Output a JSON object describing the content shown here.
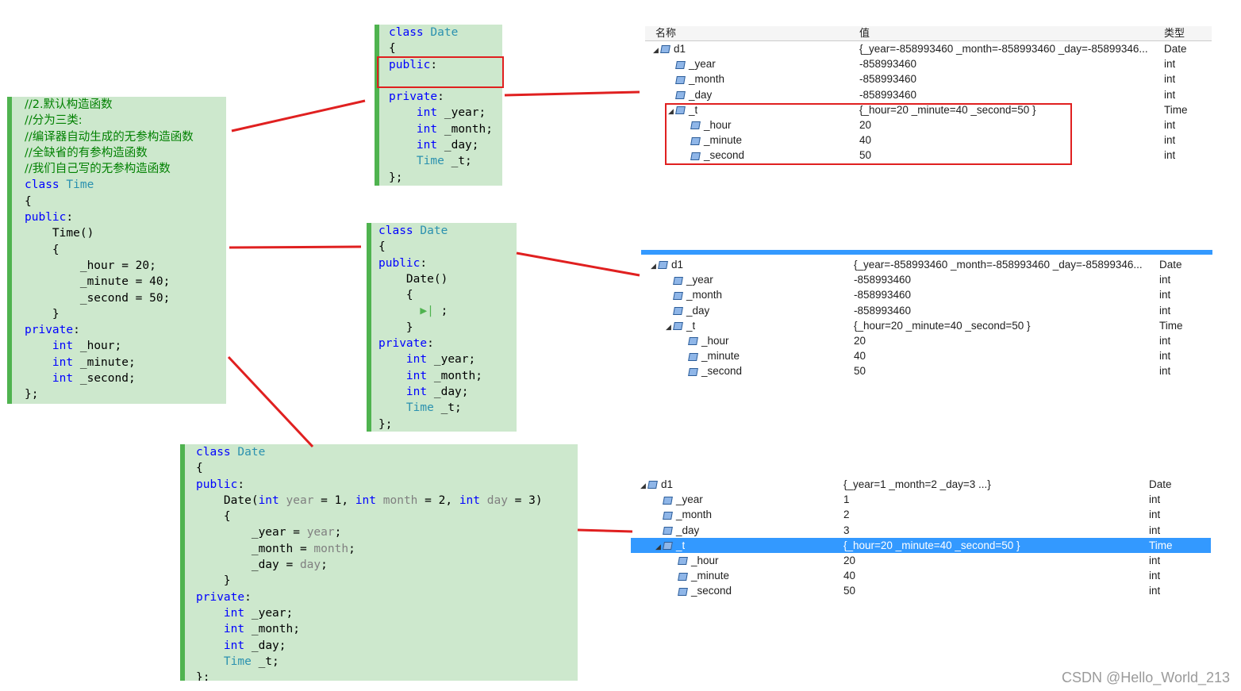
{
  "panel_time": {
    "lines": [
      [
        {
          "c": "cm",
          "t": "//2.默认构造函数"
        }
      ],
      [
        {
          "c": "cm",
          "t": "//分为三类:"
        }
      ],
      [
        {
          "c": "cm",
          "t": "//编译器自动生成的无参构造函数"
        }
      ],
      [
        {
          "c": "cm",
          "t": "//全缺省的有参构造函数"
        }
      ],
      [
        {
          "c": "cm",
          "t": "//我们自己写的无参构造函数"
        }
      ],
      [
        {
          "c": "kw",
          "t": "class "
        },
        {
          "c": "ty",
          "t": "Time"
        }
      ],
      [
        {
          "c": "tx",
          "t": "{"
        }
      ],
      [
        {
          "c": "kw",
          "t": "public"
        },
        {
          "c": "tx",
          "t": ":"
        }
      ],
      [
        {
          "c": "tx",
          "t": "    Time()"
        }
      ],
      [
        {
          "c": "tx",
          "t": "    {"
        }
      ],
      [
        {
          "c": "tx",
          "t": "        _hour = 20;"
        }
      ],
      [
        {
          "c": "tx",
          "t": "        _minute = 40;"
        }
      ],
      [
        {
          "c": "tx",
          "t": "        _second = 50;"
        }
      ],
      [
        {
          "c": "tx",
          "t": "    }"
        }
      ],
      [
        {
          "c": "kw",
          "t": "private"
        },
        {
          "c": "tx",
          "t": ":"
        }
      ],
      [
        {
          "c": "tx",
          "t": "    "
        },
        {
          "c": "kw",
          "t": "int"
        },
        {
          "c": "tx",
          "t": " _hour;"
        }
      ],
      [
        {
          "c": "tx",
          "t": "    "
        },
        {
          "c": "kw",
          "t": "int"
        },
        {
          "c": "tx",
          "t": " _minute;"
        }
      ],
      [
        {
          "c": "tx",
          "t": "    "
        },
        {
          "c": "kw",
          "t": "int"
        },
        {
          "c": "tx",
          "t": " _second;"
        }
      ],
      [
        {
          "c": "tx",
          "t": "};"
        }
      ]
    ]
  },
  "panel_date1": {
    "lines": [
      [
        {
          "c": "kw",
          "t": "class "
        },
        {
          "c": "ty",
          "t": "Date"
        }
      ],
      [
        {
          "c": "tx",
          "t": "{"
        }
      ],
      [
        {
          "c": "kw",
          "t": "public"
        },
        {
          "c": "tx",
          "t": ":"
        }
      ],
      [
        {
          "c": "tx",
          "t": ""
        }
      ],
      [
        {
          "c": "kw",
          "t": "private"
        },
        {
          "c": "tx",
          "t": ":"
        }
      ],
      [
        {
          "c": "tx",
          "t": "    "
        },
        {
          "c": "kw",
          "t": "int"
        },
        {
          "c": "tx",
          "t": " _year;"
        }
      ],
      [
        {
          "c": "tx",
          "t": "    "
        },
        {
          "c": "kw",
          "t": "int"
        },
        {
          "c": "tx",
          "t": " _month;"
        }
      ],
      [
        {
          "c": "tx",
          "t": "    "
        },
        {
          "c": "kw",
          "t": "int"
        },
        {
          "c": "tx",
          "t": " _day;"
        }
      ],
      [
        {
          "c": "tx",
          "t": "    "
        },
        {
          "c": "ty",
          "t": "Time"
        },
        {
          "c": "tx",
          "t": " _t;"
        }
      ],
      [
        {
          "c": "tx",
          "t": "};"
        }
      ]
    ]
  },
  "panel_date2": {
    "lines": [
      [
        {
          "c": "kw",
          "t": "class "
        },
        {
          "c": "ty",
          "t": "Date"
        }
      ],
      [
        {
          "c": "tx",
          "t": "{"
        }
      ],
      [
        {
          "c": "kw",
          "t": "public"
        },
        {
          "c": "tx",
          "t": ":"
        }
      ],
      [
        {
          "c": "tx",
          "t": "    Date()"
        }
      ],
      [
        {
          "c": "tx",
          "t": "    {"
        }
      ],
      [
        {
          "c": "tx",
          "t": "      "
        },
        {
          "c": "arrow",
          "t": "▶|"
        },
        {
          "c": "tx",
          "t": " ;"
        }
      ],
      [
        {
          "c": "tx",
          "t": "    }"
        }
      ],
      [
        {
          "c": "kw",
          "t": "private"
        },
        {
          "c": "tx",
          "t": ":"
        }
      ],
      [
        {
          "c": "tx",
          "t": "    "
        },
        {
          "c": "kw",
          "t": "int"
        },
        {
          "c": "tx",
          "t": " _year;"
        }
      ],
      [
        {
          "c": "tx",
          "t": "    "
        },
        {
          "c": "kw",
          "t": "int"
        },
        {
          "c": "tx",
          "t": " _month;"
        }
      ],
      [
        {
          "c": "tx",
          "t": "    "
        },
        {
          "c": "kw",
          "t": "int"
        },
        {
          "c": "tx",
          "t": " _day;"
        }
      ],
      [
        {
          "c": "tx",
          "t": "    "
        },
        {
          "c": "ty",
          "t": "Time"
        },
        {
          "c": "tx",
          "t": " _t;"
        }
      ],
      [
        {
          "c": "tx",
          "t": "};"
        }
      ]
    ]
  },
  "panel_date3": {
    "lines": [
      [
        {
          "c": "kw",
          "t": "class "
        },
        {
          "c": "ty",
          "t": "Date"
        }
      ],
      [
        {
          "c": "tx",
          "t": "{"
        }
      ],
      [
        {
          "c": "kw",
          "t": "public"
        },
        {
          "c": "tx",
          "t": ":"
        }
      ],
      [
        {
          "c": "tx",
          "t": "    Date("
        },
        {
          "c": "kw",
          "t": "int"
        },
        {
          "c": "pm",
          "t": " year"
        },
        {
          "c": "tx",
          "t": " = 1, "
        },
        {
          "c": "kw",
          "t": "int"
        },
        {
          "c": "pm",
          "t": " month"
        },
        {
          "c": "tx",
          "t": " = 2, "
        },
        {
          "c": "kw",
          "t": "int"
        },
        {
          "c": "pm",
          "t": " day"
        },
        {
          "c": "tx",
          "t": " = 3)"
        }
      ],
      [
        {
          "c": "tx",
          "t": "    {"
        }
      ],
      [
        {
          "c": "tx",
          "t": "        _year = "
        },
        {
          "c": "pm",
          "t": "year"
        },
        {
          "c": "tx",
          "t": ";"
        }
      ],
      [
        {
          "c": "tx",
          "t": "        _month = "
        },
        {
          "c": "pm",
          "t": "month"
        },
        {
          "c": "tx",
          "t": ";"
        }
      ],
      [
        {
          "c": "tx",
          "t": "        _day = "
        },
        {
          "c": "pm",
          "t": "day"
        },
        {
          "c": "tx",
          "t": ";"
        }
      ],
      [
        {
          "c": "tx",
          "t": "    }"
        }
      ],
      [
        {
          "c": "kw",
          "t": "private"
        },
        {
          "c": "tx",
          "t": ":"
        }
      ],
      [
        {
          "c": "tx",
          "t": "    "
        },
        {
          "c": "kw",
          "t": "int"
        },
        {
          "c": "tx",
          "t": " _year;"
        }
      ],
      [
        {
          "c": "tx",
          "t": "    "
        },
        {
          "c": "kw",
          "t": "int"
        },
        {
          "c": "tx",
          "t": " _month;"
        }
      ],
      [
        {
          "c": "tx",
          "t": "    "
        },
        {
          "c": "kw",
          "t": "int"
        },
        {
          "c": "tx",
          "t": " _day;"
        }
      ],
      [
        {
          "c": "tx",
          "t": "    "
        },
        {
          "c": "ty",
          "t": "Time"
        },
        {
          "c": "tx",
          "t": " _t;"
        }
      ],
      [
        {
          "c": "tx",
          "t": "};"
        }
      ]
    ]
  },
  "watch1": {
    "headers": {
      "name": "名称",
      "value": "值",
      "type": "类型"
    },
    "rows": [
      {
        "tri": "◢",
        "indent": 0,
        "name": "d1",
        "value": "{_year=-858993460 _month=-858993460 _day=-85899346...",
        "type": "Date"
      },
      {
        "tri": "",
        "indent": 1,
        "name": "_year",
        "value": "-858993460",
        "type": "int"
      },
      {
        "tri": "",
        "indent": 1,
        "name": "_month",
        "value": "-858993460",
        "type": "int"
      },
      {
        "tri": "",
        "indent": 1,
        "name": "_day",
        "value": "-858993460",
        "type": "int"
      },
      {
        "tri": "◢",
        "indent": 1,
        "name": "_t",
        "value": "{_hour=20 _minute=40 _second=50 }",
        "type": "Time"
      },
      {
        "tri": "",
        "indent": 2,
        "name": "_hour",
        "value": "20",
        "type": "int"
      },
      {
        "tri": "",
        "indent": 2,
        "name": "_minute",
        "value": "40",
        "type": "int"
      },
      {
        "tri": "",
        "indent": 2,
        "name": "_second",
        "value": "50",
        "type": "int"
      }
    ]
  },
  "watch2": {
    "rows": [
      {
        "tri": "◢",
        "indent": 0,
        "name": "d1",
        "value": "{_year=-858993460 _month=-858993460 _day=-85899346...",
        "type": "Date"
      },
      {
        "tri": "",
        "indent": 1,
        "name": "_year",
        "value": "-858993460",
        "type": "int"
      },
      {
        "tri": "",
        "indent": 1,
        "name": "_month",
        "value": "-858993460",
        "type": "int"
      },
      {
        "tri": "",
        "indent": 1,
        "name": "_day",
        "value": "-858993460",
        "type": "int"
      },
      {
        "tri": "◢",
        "indent": 1,
        "name": "_t",
        "value": "{_hour=20 _minute=40 _second=50 }",
        "type": "Time"
      },
      {
        "tri": "",
        "indent": 2,
        "name": "_hour",
        "value": "20",
        "type": "int"
      },
      {
        "tri": "",
        "indent": 2,
        "name": "_minute",
        "value": "40",
        "type": "int"
      },
      {
        "tri": "",
        "indent": 2,
        "name": "_second",
        "value": "50",
        "type": "int"
      }
    ]
  },
  "watch3": {
    "rows": [
      {
        "tri": "◢",
        "indent": 0,
        "name": "d1",
        "value": "{_year=1 _month=2 _day=3 ...}",
        "type": "Date"
      },
      {
        "tri": "",
        "indent": 1,
        "name": "_year",
        "value": "1",
        "type": "int"
      },
      {
        "tri": "",
        "indent": 1,
        "name": "_month",
        "value": "2",
        "type": "int"
      },
      {
        "tri": "",
        "indent": 1,
        "name": "_day",
        "value": "3",
        "type": "int"
      },
      {
        "tri": "◢",
        "indent": 1,
        "name": "_t",
        "value": "{_hour=20 _minute=40 _second=50 }",
        "type": "Time",
        "selected": true
      },
      {
        "tri": "",
        "indent": 2,
        "name": "_hour",
        "value": "20",
        "type": "int"
      },
      {
        "tri": "",
        "indent": 2,
        "name": "_minute",
        "value": "40",
        "type": "int"
      },
      {
        "tri": "",
        "indent": 2,
        "name": "_second",
        "value": "50",
        "type": "int"
      }
    ]
  },
  "watermark": "CSDN @Hello_World_213",
  "colors": {
    "annotation": "#e02020",
    "code_bg": "#cde8cd",
    "keyword": "#0000ff",
    "type": "#2b91af",
    "comment": "#008000",
    "selection": "#3399ff"
  }
}
